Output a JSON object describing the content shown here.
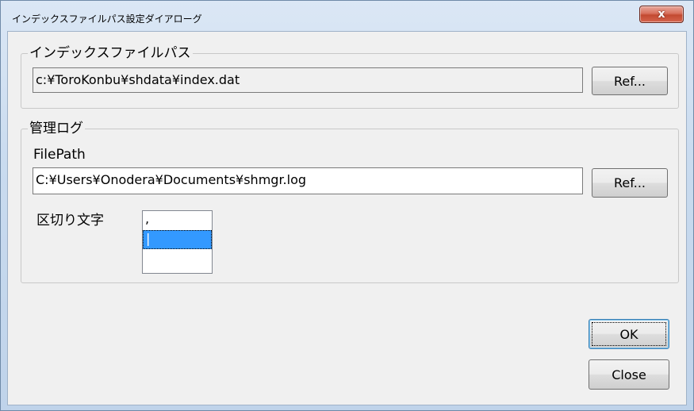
{
  "window": {
    "title": "インデックスファイルパス設定ダイアローグ",
    "close_glyph": "x"
  },
  "index_group": {
    "label": "インデックスファイルパス",
    "path_value": "c:¥ToroKonbu¥shdata¥index.dat",
    "ref_label": "Ref..."
  },
  "log_group": {
    "label": "管理ログ",
    "filepath_label": "FilePath",
    "filepath_value": "C:¥Users¥Onodera¥Documents¥shmgr.log",
    "ref_label": "Ref...",
    "delimiter_label": "区切り文字",
    "delimiter_options": [
      ",",
      "|",
      ""
    ],
    "selected_index": 1
  },
  "buttons": {
    "ok_label": "OK",
    "close_label": "Close"
  }
}
